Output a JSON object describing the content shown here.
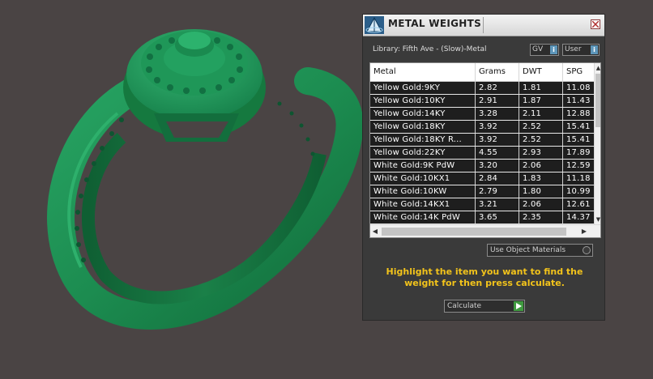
{
  "panel": {
    "title": "METAL WEIGHTS",
    "library_label": "Library: Fifth Ave - (Slow)-Metal",
    "gv_chip": "GV",
    "user_chip": "User",
    "info_glyph": "i"
  },
  "table": {
    "headers": [
      "Metal",
      "Grams",
      "DWT",
      "SPG"
    ],
    "rows": [
      [
        "Yellow Gold:9KY",
        "2.82",
        "1.81",
        "11.08"
      ],
      [
        "Yellow Gold:10KY",
        "2.91",
        "1.87",
        "11.43"
      ],
      [
        "Yellow Gold:14KY",
        "3.28",
        "2.11",
        "12.88"
      ],
      [
        "Yellow Gold:18KY",
        "3.92",
        "2.52",
        "15.41"
      ],
      [
        "Yellow Gold:18KY R...",
        "3.92",
        "2.52",
        "15.41"
      ],
      [
        "Yellow Gold:22KY",
        "4.55",
        "2.93",
        "17.89"
      ],
      [
        "White Gold:9K PdW",
        "3.20",
        "2.06",
        "12.59"
      ],
      [
        "White Gold:10KX1",
        "2.84",
        "1.83",
        "11.18"
      ],
      [
        "White Gold:10KW",
        "2.79",
        "1.80",
        "10.99"
      ],
      [
        "White Gold:14KX1",
        "3.21",
        "2.06",
        "12.61"
      ],
      [
        "White Gold:14K PdW",
        "3.65",
        "2.35",
        "14.37"
      ]
    ]
  },
  "use_object_materials_label": "Use Object Materials",
  "instructions": "Highlight the item you want to find the weight for then press calculate.",
  "calculate_label": "Calculate",
  "colors": {
    "viewport_bg": "#4a4444",
    "ring_green": "#1e8a52",
    "panel_bg": "#3a3a3a",
    "accent_yellow": "#f2c31b",
    "selected_row_bg": "#1e1e1e",
    "info_blue": "#5d96ba",
    "play_green": "#3f9a3f"
  },
  "icons": {
    "app": "pyramid-icon",
    "close": "close-icon",
    "info": "info-icon",
    "radio": "radio-icon",
    "play": "play-icon",
    "scroll_up": "scroll-up-arrow-icon",
    "scroll_down": "scroll-down-arrow-icon",
    "scroll_left": "scroll-left-arrow-icon",
    "scroll_right": "scroll-right-arrow-icon"
  }
}
